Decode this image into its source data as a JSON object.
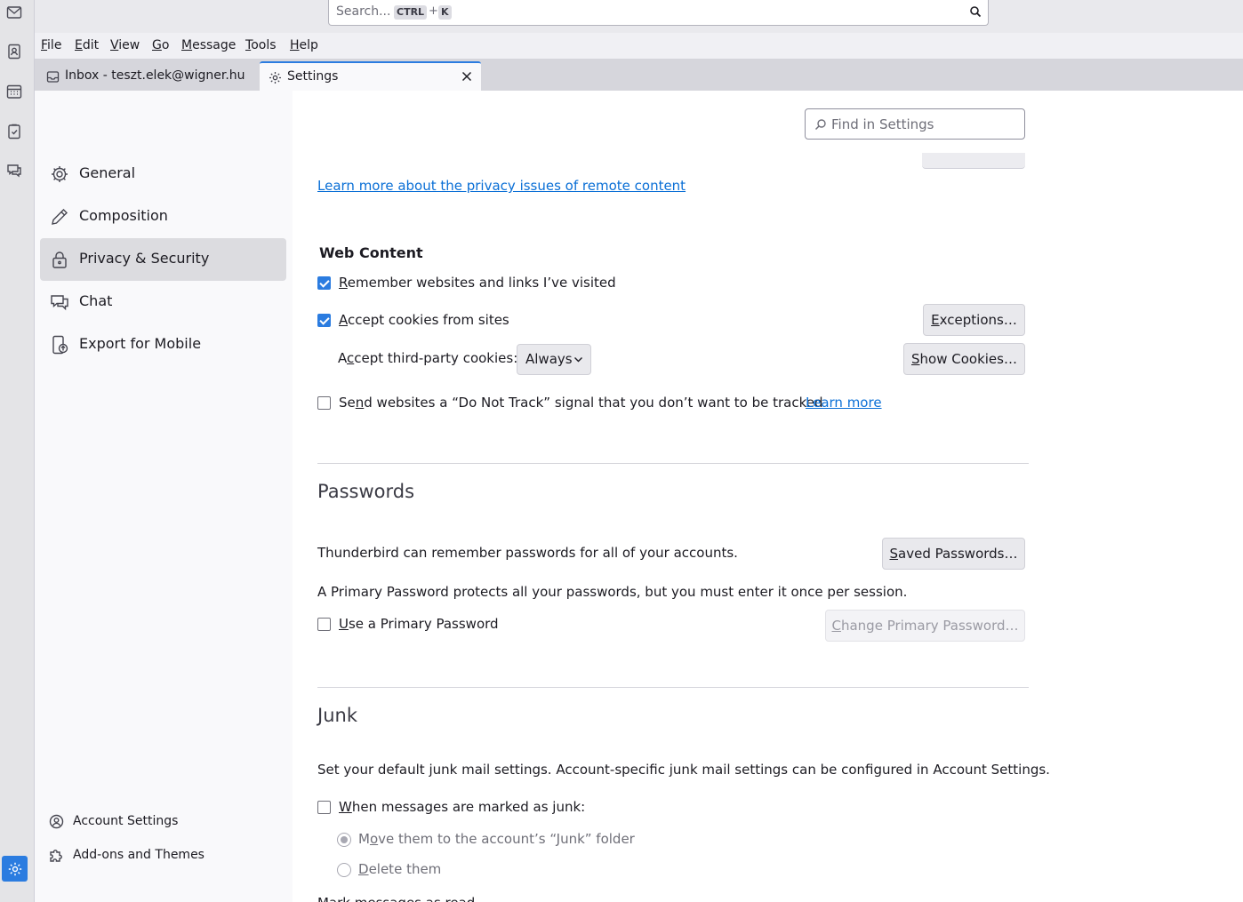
{
  "search": {
    "placeholder": "Search...",
    "key1": "CTRL",
    "plus": "+",
    "key2": "K"
  },
  "menubar": [
    {
      "label": "File",
      "first": "F",
      "rest": "ile"
    },
    {
      "label": "Edit",
      "first": "E",
      "rest": "dit"
    },
    {
      "label": "View",
      "first": "V",
      "rest": "iew"
    },
    {
      "label": "Go",
      "first": "G",
      "rest": "o"
    },
    {
      "label": "Message",
      "first": "M",
      "rest": "essage"
    },
    {
      "label": "Tools",
      "first": "T",
      "rest": "ools"
    },
    {
      "label": "Help",
      "first": "H",
      "rest": "elp"
    }
  ],
  "tabs": {
    "inbox": {
      "label": "Inbox - teszt.elek@wigner.hu"
    },
    "settings": {
      "label": "Settings"
    }
  },
  "nav": {
    "items": [
      {
        "label": "General",
        "icon": "gear-icon"
      },
      {
        "label": "Composition",
        "icon": "pencil-icon"
      },
      {
        "label": "Privacy & Security",
        "icon": "lock-icon",
        "selected": true
      },
      {
        "label": "Chat",
        "icon": "chat-icon"
      },
      {
        "label": "Export for Mobile",
        "icon": "mobile-export-icon"
      }
    ],
    "footer": [
      {
        "label": "Account Settings",
        "icon": "account-settings-icon"
      },
      {
        "label": "Add-ons and Themes",
        "icon": "puzzle-icon"
      }
    ]
  },
  "find": {
    "placeholder": "Find in Settings"
  },
  "remote_content": {
    "learn_more_link": "Learn more about the privacy issues of remote content"
  },
  "web_content": {
    "heading": "Web Content",
    "remember_pre": "",
    "remember_acc": "R",
    "remember_post": "emember websites and links I’ve visited",
    "remember_checked": true,
    "cookies_acc": "A",
    "cookies_post": "ccept cookies from sites",
    "cookies_checked": true,
    "exceptions_acc": "E",
    "exceptions_post": "xceptions…",
    "third_party_pre": "A",
    "third_party_acc": "c",
    "third_party_post": "cept third-party cookies:",
    "third_party_value": "Always",
    "show_cookies_acc": "S",
    "show_cookies_post": "how Cookies…",
    "dnt_pre": "Se",
    "dnt_acc": "n",
    "dnt_post": "d websites a “Do Not Track” signal that you don’t want to be tracked",
    "dnt_checked": false,
    "dnt_learn_more": "Learn more"
  },
  "passwords": {
    "heading": "Passwords",
    "remember_text": "Thunderbird can remember passwords for all of your accounts.",
    "saved_acc": "S",
    "saved_post": "aved Passwords…",
    "primary_text": "A Primary Password protects all your passwords, but you must enter it once per session.",
    "use_primary_acc": "U",
    "use_primary_post": "se a Primary Password",
    "use_primary_checked": false,
    "change_primary_acc": "C",
    "change_primary_post": "hange Primary Password…"
  },
  "junk": {
    "heading": "Junk",
    "description": "Set your default junk mail settings. Account-specific junk mail settings can be configured in Account Settings.",
    "marked_acc": "W",
    "marked_post": "hen messages are marked as junk:",
    "marked_checked": false,
    "move_pre": "M",
    "move_acc": "o",
    "move_post": "ve them to the account’s “Junk” folder",
    "delete_acc": "D",
    "delete_post": "elete them",
    "cutoff_text": "Mark messages as read"
  },
  "colors": {
    "accent": "#2b7ce0",
    "link": "#0a6fd6",
    "selected_nav": "#dcdce0"
  }
}
